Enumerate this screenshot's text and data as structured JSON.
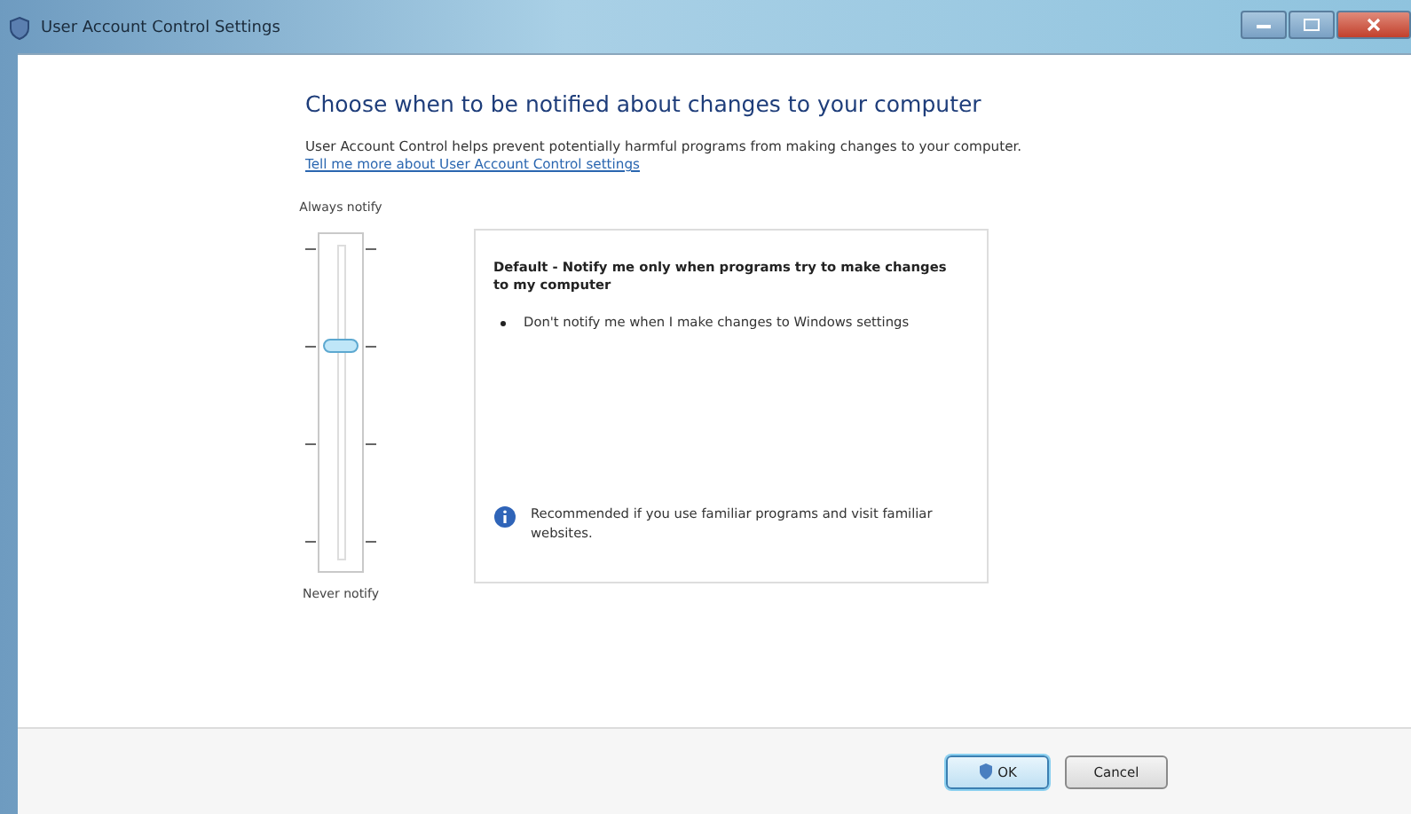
{
  "window": {
    "title": "User Account Control Settings"
  },
  "heading": "Choose when to be notified about changes to your computer",
  "description": "User Account Control helps prevent potentially harmful programs from making changes to your computer.",
  "link": "Tell me more about User Account Control settings",
  "slider": {
    "top_label": "Always notify",
    "bottom_label": "Never notify",
    "level": 0.667
  },
  "info": {
    "title": "Default - Notify me only when programs try to make changes to my computer",
    "bullets": [
      "Don't notify me when I make changes to Windows settings"
    ],
    "note": "Recommended if you use familiar programs and visit familiar websites."
  },
  "buttons": [
    {
      "label": "OK",
      "kind": "shield"
    },
    {
      "label": "Cancel",
      "kind": "plain"
    }
  ]
}
